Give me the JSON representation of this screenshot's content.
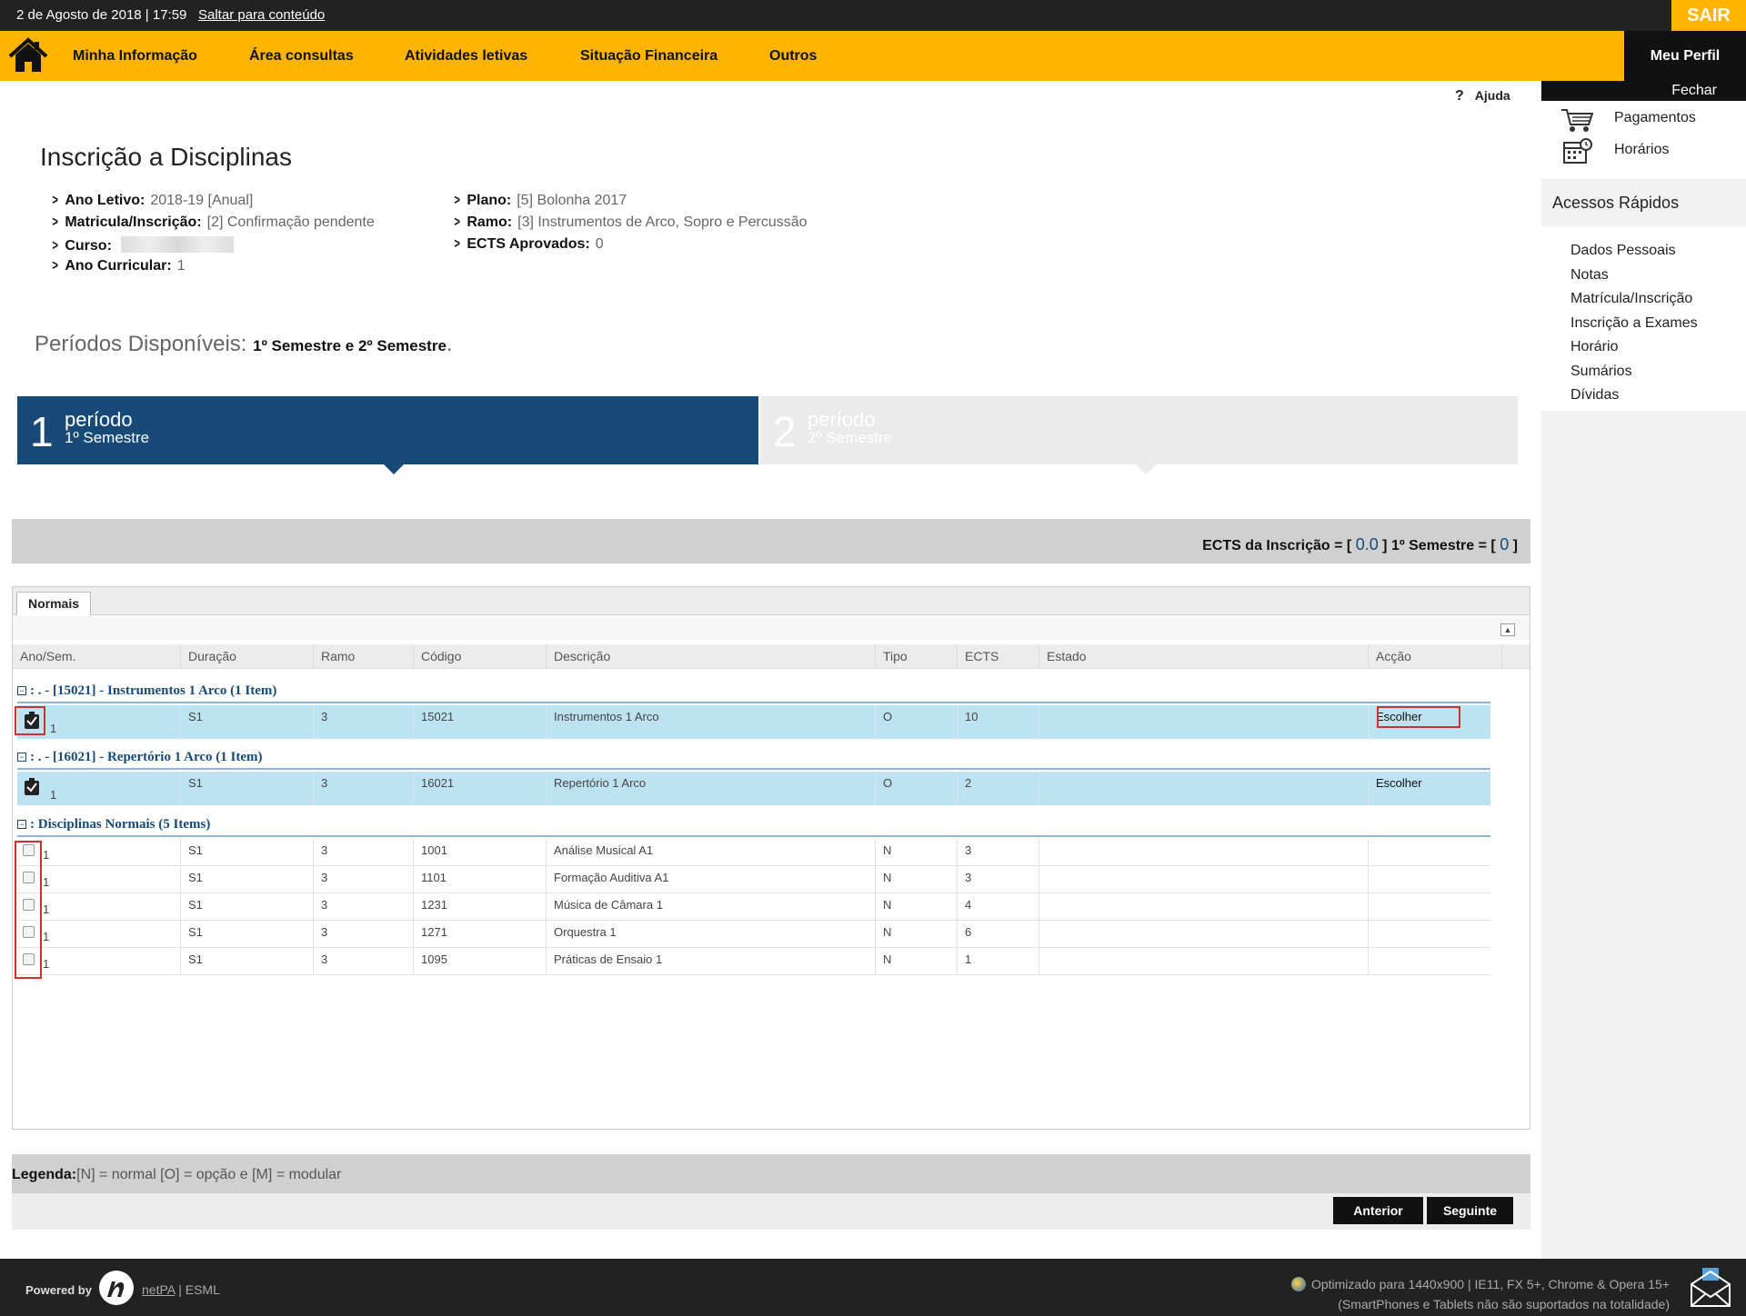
{
  "topbar": {
    "date": "2 de Agosto de 2018 | 17:59",
    "skip": "Saltar para conteúdo",
    "logout": "SAIR"
  },
  "nav": {
    "items": [
      "Minha Informação",
      "Área consultas",
      "Atividades letivas",
      "Situação Financeira",
      "Outros"
    ],
    "profile": "Meu Perfil"
  },
  "help": "Ajuda",
  "sidebar": {
    "close": "Fechar",
    "links": [
      "Pagamentos",
      "Horários"
    ],
    "quick_title": "Acessos Rápidos",
    "quick_links": [
      "Dados Pessoais",
      "Notas",
      "Matrícula/Inscrição",
      "Inscrição a Exames",
      "Horário",
      "Sumários",
      "Dívidas"
    ]
  },
  "page": {
    "title": "Inscrição a Disciplinas",
    "info_left": [
      {
        "label": "Ano Letivo:",
        "value": "2018-19 [Anual]"
      },
      {
        "label": "Matricula/Inscrição:",
        "value": "[2] Confirmação pendente"
      },
      {
        "label": "Curso:",
        "value": ""
      },
      {
        "label": "Ano Curricular:",
        "value": "1"
      }
    ],
    "info_right": [
      {
        "label": "Plano:",
        "value": "[5] Bolonha 2017"
      },
      {
        "label": "Ramo:",
        "value": "[3] Instrumentos de Arco, Sopro e Percussão"
      },
      {
        "label": "ECTS Aprovados:",
        "value": "0"
      }
    ],
    "periods_label": "Períodos Disponíveis:",
    "periods_value": "1º Semestre e 2º Semestre",
    "periods_dot": "."
  },
  "period_tabs": [
    {
      "num": "1",
      "label": "período",
      "sub": "1º Semestre"
    },
    {
      "num": "2",
      "label": "período",
      "sub": "2º Semestre"
    }
  ],
  "ects": {
    "prefix": "ECTS da Inscrição = [",
    "total": "0.0",
    "middle": "] 1º Semestre = [",
    "sem": "0",
    "suffix": "]"
  },
  "grid": {
    "tab": "Normais",
    "headers": [
      "Ano/Sem.",
      "Duração",
      "Ramo",
      "Código",
      "Descrição",
      "Tipo",
      "ECTS",
      "Estado",
      "Acção"
    ],
    "groups": [
      {
        "title": ": . - [15021] - Instrumentos 1 Arco (1 Item)"
      },
      {
        "title": ": . - [16021] - Repertório 1 Arco (1 Item)"
      },
      {
        "title": ": Disciplinas Normais (5 Items)"
      }
    ],
    "option_rows": [
      {
        "ano": "1",
        "dur": "S1",
        "ramo": "3",
        "cod": "15021",
        "desc": "Instrumentos 1 Arco",
        "tipo": "O",
        "ects": "10",
        "estado": "",
        "accao": "Escolher"
      },
      {
        "ano": "1",
        "dur": "S1",
        "ramo": "3",
        "cod": "16021",
        "desc": "Repertório 1 Arco",
        "tipo": "O",
        "ects": "2",
        "estado": "",
        "accao": "Escolher"
      }
    ],
    "normal_rows": [
      {
        "ano": "1",
        "dur": "S1",
        "ramo": "3",
        "cod": "1001",
        "desc": "Análise Musical A1",
        "tipo": "N",
        "ects": "3"
      },
      {
        "ano": "1",
        "dur": "S1",
        "ramo": "3",
        "cod": "1101",
        "desc": "Formação Auditiva A1",
        "tipo": "N",
        "ects": "3"
      },
      {
        "ano": "1",
        "dur": "S1",
        "ramo": "3",
        "cod": "1231",
        "desc": "Música de Câmara 1",
        "tipo": "N",
        "ects": "4"
      },
      {
        "ano": "1",
        "dur": "S1",
        "ramo": "3",
        "cod": "1271",
        "desc": "Orquestra 1",
        "tipo": "N",
        "ects": "6"
      },
      {
        "ano": "1",
        "dur": "S1",
        "ramo": "3",
        "cod": "1095",
        "desc": "Práticas de Ensaio 1",
        "tipo": "N",
        "ects": "1"
      }
    ]
  },
  "legend": {
    "label": "Legenda:",
    "text": "[N] = normal [O] = opção e [M] = modular"
  },
  "buttons": {
    "prev": "Anterior",
    "next": "Seguinte"
  },
  "footer": {
    "powered": "Powered by",
    "netpa": "netPA",
    "school": "| ESML",
    "opt1": "Optimizado para 1440x900 | IE11, FX 5+, Chrome & Opera 15+",
    "opt2": "(SmartPhones e Tablets não são suportados na totalidade)"
  },
  "colors": {
    "accent": "#ffb400",
    "primary": "#174a77",
    "highlight": "#bde3f2",
    "marker": "#d32f2f"
  }
}
